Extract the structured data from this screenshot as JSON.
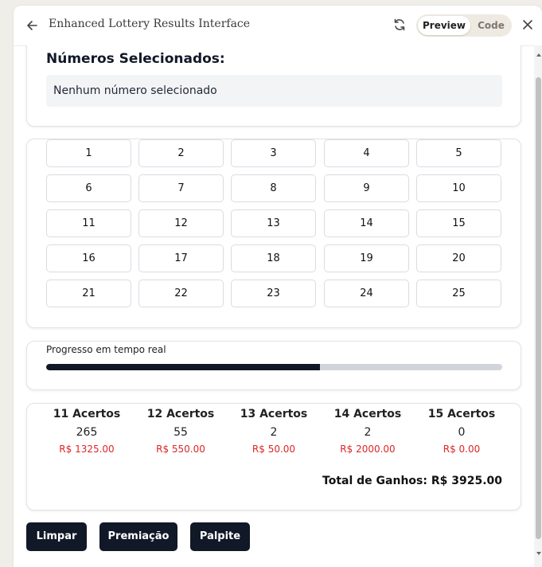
{
  "window": {
    "title": "Enhanced Lottery Results Interface",
    "toggle": {
      "preview_label": "Preview",
      "code_label": "Code",
      "active": "Preview"
    }
  },
  "selected": {
    "heading": "Números Selecionados:",
    "empty_text": "Nenhum número selecionado"
  },
  "grid": {
    "numbers": [
      "1",
      "2",
      "3",
      "4",
      "5",
      "6",
      "7",
      "8",
      "9",
      "10",
      "11",
      "12",
      "13",
      "14",
      "15",
      "16",
      "17",
      "18",
      "19",
      "20",
      "21",
      "22",
      "23",
      "24",
      "25"
    ]
  },
  "progress": {
    "label": "Progresso em tempo real",
    "fraction": 0.6
  },
  "results": {
    "columns": [
      {
        "title": "11 Acertos",
        "count": "265",
        "prize": "R$ 1325.00"
      },
      {
        "title": "12 Acertos",
        "count": "55",
        "prize": "R$ 550.00"
      },
      {
        "title": "13 Acertos",
        "count": "2",
        "prize": "R$ 50.00"
      },
      {
        "title": "14 Acertos",
        "count": "2",
        "prize": "R$ 2000.00"
      },
      {
        "title": "15 Acertos",
        "count": "0",
        "prize": "R$ 0.00"
      }
    ],
    "total": "Total de Ganhos: R$ 3925.00"
  },
  "actions": {
    "limpar_label": "Limpar",
    "premiacao_label": "Premiação",
    "palpite_label": "Palpite"
  },
  "colors": {
    "primary": "#111827",
    "prize_red": "#dc2626",
    "progress_track": "#d1d5db"
  },
  "icons": [
    "arrow-left-icon",
    "refresh-icon",
    "close-icon"
  ]
}
